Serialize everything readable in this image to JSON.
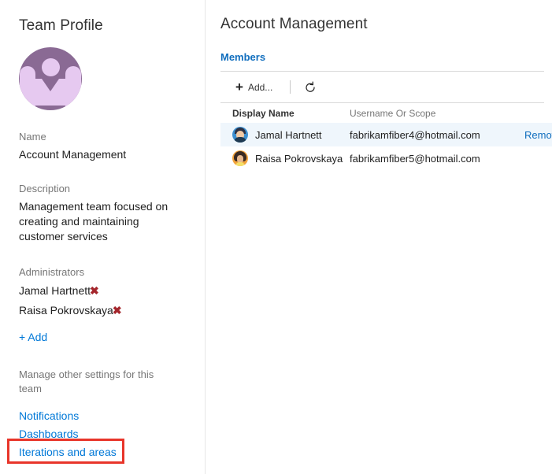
{
  "left": {
    "title": "Team Profile",
    "avatar_icon": "team-group-icon",
    "name_label": "Name",
    "name_value": "Account Management",
    "description_label": "Description",
    "description_value": "Management team focused on creating and maintaining customer services",
    "administrators_label": "Administrators",
    "administrators": [
      {
        "name": "Jamal Hartnett",
        "remove_icon": "remove-x-icon"
      },
      {
        "name": "Raisa Pokrovskaya",
        "remove_icon": "remove-x-icon"
      }
    ],
    "add_admin_label": "+ Add",
    "manage_heading": "Manage other settings for this team",
    "settings_links": [
      {
        "label": "Notifications"
      },
      {
        "label": "Dashboards"
      },
      {
        "label": "Iterations and areas"
      }
    ],
    "highlighted_link": "Iterations and areas",
    "highlight_color": "#e8352a"
  },
  "right": {
    "title": "Account Management",
    "tabs": [
      {
        "label": "Members",
        "active": true
      }
    ],
    "toolbar": {
      "add_label": "Add...",
      "add_icon": "plus-icon",
      "refresh_icon": "refresh-icon"
    },
    "table": {
      "columns": [
        "Display Name",
        "Username Or Scope"
      ],
      "rows": [
        {
          "avatar": "avatar-male",
          "display_name": "Jamal Hartnett",
          "username": "fabrikamfiber4@hotmail.com",
          "action": "Remove",
          "selected": true
        },
        {
          "avatar": "avatar-female",
          "display_name": "Raisa Pokrovskaya",
          "username": "fabrikamfiber5@hotmail.com",
          "action": "",
          "selected": false
        }
      ]
    }
  },
  "colors": {
    "accent_link": "#0078d7",
    "tab_blue": "#106ebe",
    "row_highlight": "#eff6fc",
    "admin_remove": "#a4262c",
    "team_avatar_bg": "#8a6a94",
    "team_avatar_fg": "#e6c9f0"
  }
}
